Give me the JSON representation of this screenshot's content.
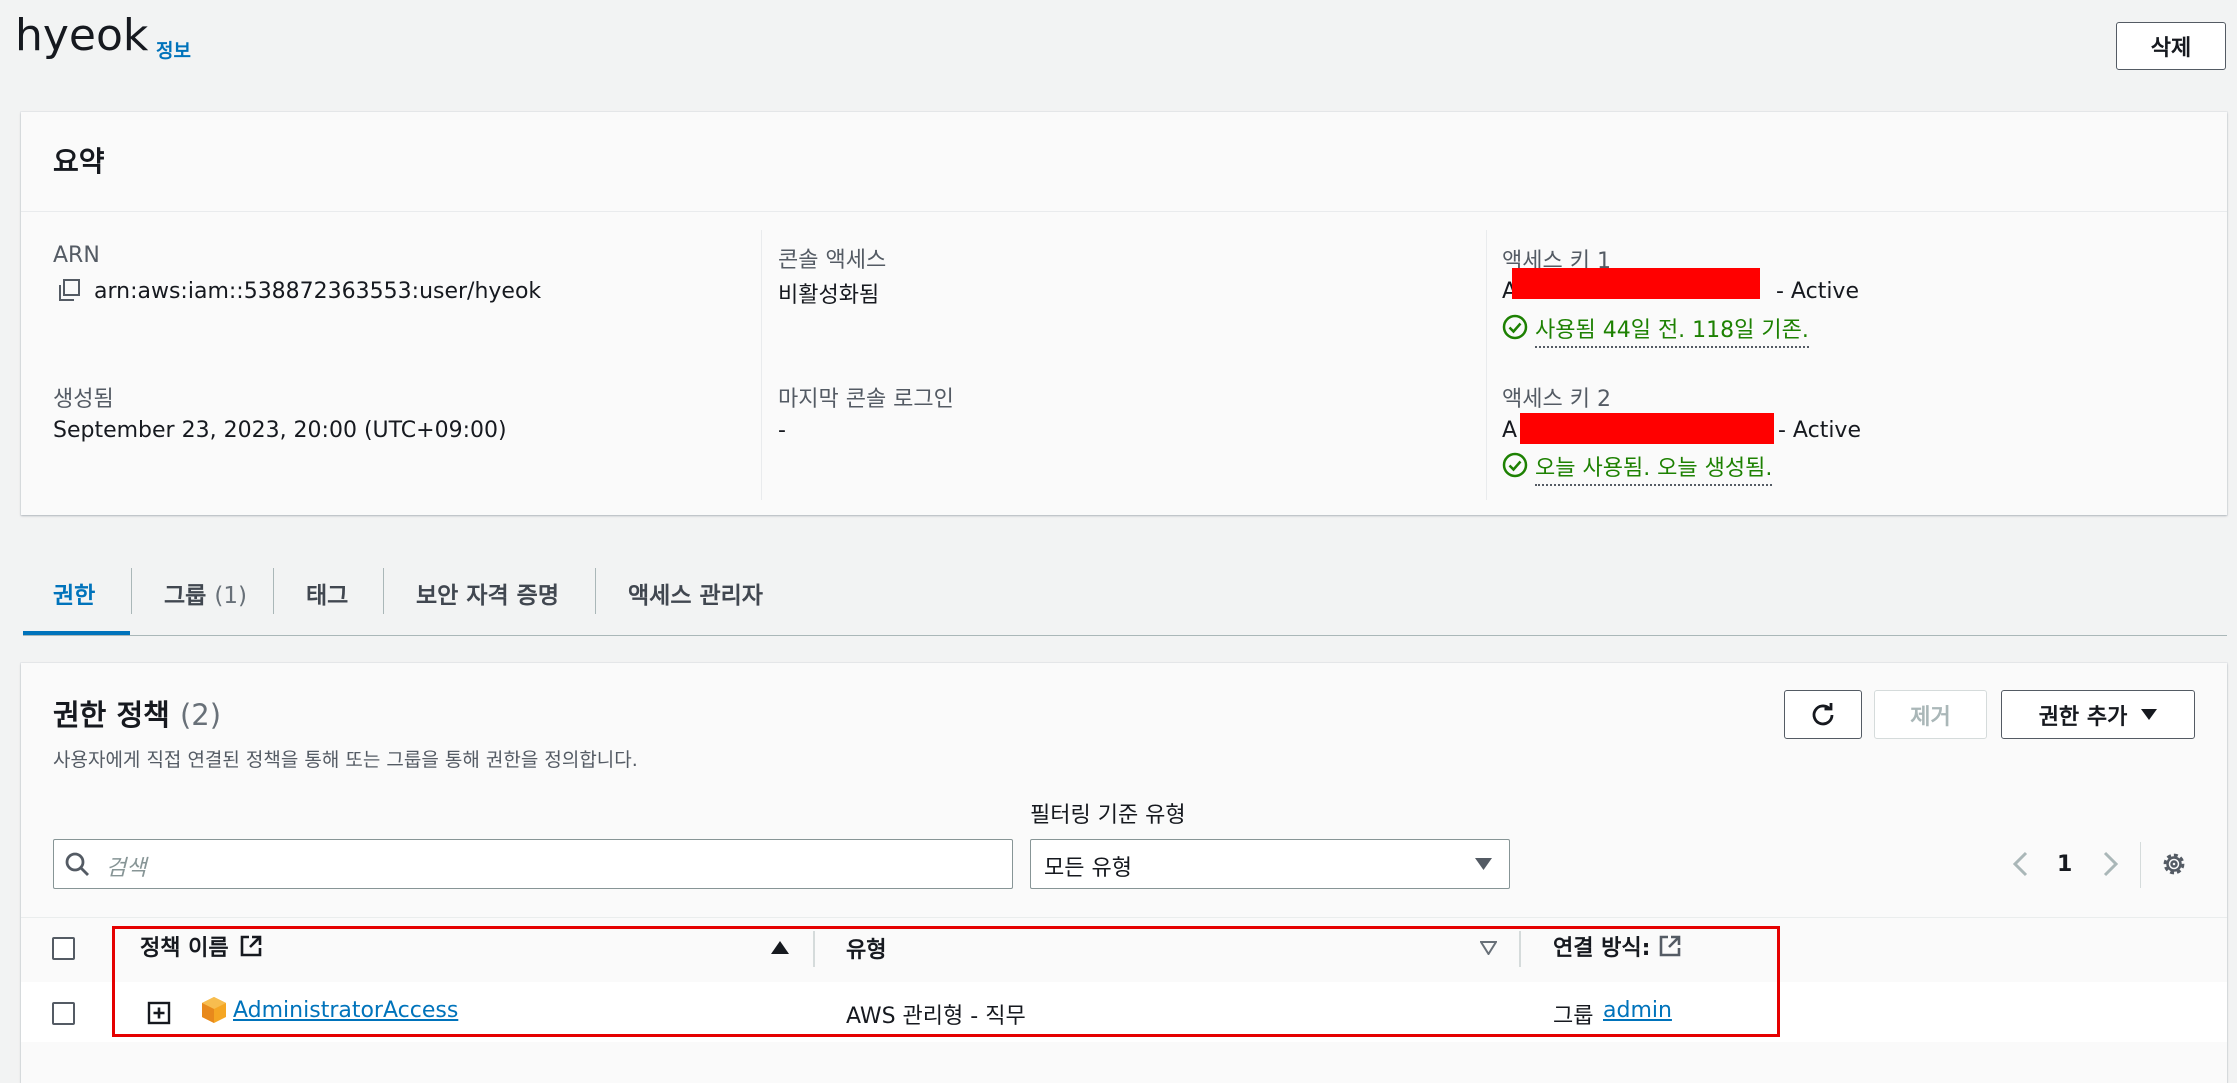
{
  "header": {
    "title": "hyeok",
    "info_link": "정보",
    "delete_label": "삭제"
  },
  "summary": {
    "title": "요약",
    "arn_label": "ARN",
    "arn_value": "arn:aws:iam::538872363553:user/hyeok",
    "created_label": "생성됨",
    "created_value": "September 23, 2023, 20:00 (UTC+09:00)",
    "console_access_label": "콘솔 액세스",
    "console_access_value": "비활성화됨",
    "last_login_label": "마지막 콘솔 로그인",
    "last_login_value": "-",
    "key1_label": "액세스 키 1",
    "key1_prefix": "A",
    "key1_status": "- Active",
    "key1_usage": "사용됨 44일 전. 118일 기존.",
    "key2_label": "액세스 키 2",
    "key2_prefix": "A",
    "key2_status": "- Active",
    "key2_usage": "오늘 사용됨. 오늘 생성됨."
  },
  "tabs": [
    {
      "label": "권한",
      "active": true
    },
    {
      "label": "그룹",
      "count": "(1)"
    },
    {
      "label": "태그"
    },
    {
      "label": "보안 자격 증명"
    },
    {
      "label": "액세스 관리자"
    }
  ],
  "permissions": {
    "title": "권한 정책",
    "count": "(2)",
    "description": "사용자에게 직접 연결된 정책을 통해 또는 그룹을 통해 권한을 정의합니다.",
    "remove_label": "제거",
    "add_label": "권한 추가",
    "filter_type_label": "필터링 기준 유형",
    "search_placeholder": "검색",
    "filter_selected": "모든 유형",
    "page_number": "1",
    "columns": {
      "policy_name": "정책 이름",
      "type": "유형",
      "attached_via": "연결 방식:"
    },
    "rows": [
      {
        "policy_name": "AdministratorAccess",
        "type": "AWS 관리형 - 직무",
        "attached_prefix": "그룹",
        "attached_link": "admin"
      }
    ]
  },
  "colors": {
    "link": "#0073bb",
    "success": "#1d8102",
    "active_tab": "#0073bb",
    "highlight_box": "#e50000",
    "redaction": "#ff0000"
  }
}
